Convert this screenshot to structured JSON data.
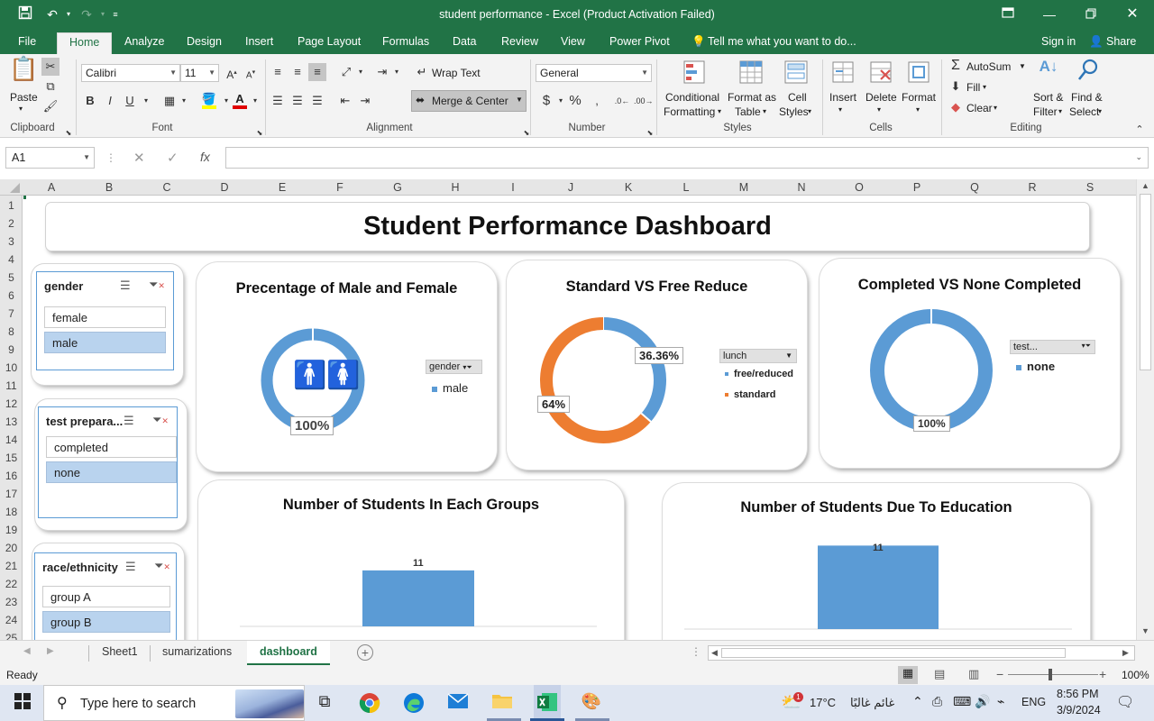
{
  "window": {
    "title": "student performance - Excel (Product Activation Failed)"
  },
  "menu": {
    "file": "File",
    "home": "Home",
    "analyze": "Analyze",
    "design": "Design",
    "insert": "Insert",
    "page_layout": "Page Layout",
    "formulas": "Formulas",
    "data": "Data",
    "review": "Review",
    "view": "View",
    "power_pivot": "Power Pivot",
    "tell_me": "Tell me what you want to do...",
    "sign_in": "Sign in",
    "share": "Share"
  },
  "ribbon": {
    "groups": {
      "clipboard": "Clipboard",
      "font": "Font",
      "alignment": "Alignment",
      "number": "Number",
      "styles": "Styles",
      "cells": "Cells",
      "editing": "Editing"
    },
    "paste": "Paste",
    "font_name": "Calibri",
    "font_size": "11",
    "bold": "B",
    "italic": "I",
    "underline": "U",
    "wrap_text": "Wrap Text",
    "merge_center": "Merge & Center",
    "number_format": "General",
    "currency": "$",
    "percent": "%",
    "conditional_formatting_1": "Conditional",
    "conditional_formatting_2": "Formatting",
    "format_as_table_1": "Format as",
    "format_as_table_2": "Table",
    "cell_styles_1": "Cell",
    "cell_styles_2": "Styles",
    "insert": "Insert",
    "delete": "Delete",
    "format": "Format",
    "autosum": "AutoSum",
    "fill": "Fill",
    "clear": "Clear",
    "sort_filter_1": "Sort &",
    "sort_filter_2": "Filter",
    "find_select_1": "Find &",
    "find_select_2": "Select"
  },
  "formula_bar": {
    "name_box": "A1",
    "fx": "fx",
    "value": ""
  },
  "columns": [
    "A",
    "B",
    "C",
    "D",
    "E",
    "F",
    "G",
    "H",
    "I",
    "J",
    "K",
    "L",
    "M",
    "N",
    "O",
    "P",
    "Q",
    "R",
    "S"
  ],
  "rows": [
    "1",
    "2",
    "3",
    "4",
    "5",
    "6",
    "7",
    "8",
    "9",
    "10",
    "11",
    "12",
    "13",
    "14",
    "15",
    "16",
    "17",
    "18",
    "19",
    "20",
    "21",
    "22",
    "23",
    "24",
    "25"
  ],
  "dashboard": {
    "title": "Student Performance Dashboard"
  },
  "slicers": {
    "gender": {
      "title": "gender",
      "items": [
        "female",
        "male"
      ],
      "selected": "male"
    },
    "test_prep": {
      "title": "test prepara...",
      "items": [
        "completed",
        "none"
      ],
      "selected": "none"
    },
    "race": {
      "title": "race/ethnicity",
      "items": [
        "group A",
        "group B"
      ],
      "selected": "group B"
    }
  },
  "chart_data": [
    {
      "type": "pie",
      "title": "Precentage  of Male and Female",
      "legend_field": "gender",
      "categories": [
        "male"
      ],
      "values": [
        100
      ],
      "data_labels": [
        "100%"
      ],
      "colors": [
        "#5b9bd5"
      ]
    },
    {
      "type": "pie",
      "title": "Standard  VS  Free Reduce",
      "legend_field": "lunch",
      "categories": [
        "free/reduced",
        "standard"
      ],
      "values": [
        36.36,
        63.64
      ],
      "data_labels": [
        "36.36%",
        "64%"
      ],
      "colors": [
        "#5b9bd5",
        "#ed7d31"
      ]
    },
    {
      "type": "pie",
      "title": "Completed  VS  None Completed",
      "legend_field": "test...",
      "categories": [
        "none"
      ],
      "values": [
        100
      ],
      "data_labels": [
        "100%"
      ],
      "colors": [
        "#5b9bd5"
      ]
    },
    {
      "type": "bar",
      "title": "Number of Students In Each Groups",
      "values": [
        11
      ],
      "data_labels": [
        "11"
      ],
      "colors": [
        "#5b9bd5"
      ]
    },
    {
      "type": "bar",
      "title": "Number of Students Due To Education",
      "values": [
        11
      ],
      "data_labels": [
        "11"
      ],
      "colors": [
        "#5b9bd5"
      ]
    }
  ],
  "sheets": {
    "tabs": [
      "Sheet1",
      "sumarizations",
      "dashboard"
    ],
    "active": "dashboard"
  },
  "status": {
    "text": "Ready",
    "zoom": "100%"
  },
  "taskbar": {
    "search_placeholder": "Type here to search",
    "temperature": "17°C",
    "weather_text": "غائم غالبًا",
    "language": "ENG",
    "time": "8:56 PM",
    "date": "3/9/2024",
    "notif_count": "1"
  },
  "colors": {
    "excel_green": "#217346",
    "series_blue": "#5b9bd5",
    "series_orange": "#ed7d31",
    "slicer_selected": "#b9d3ee"
  }
}
